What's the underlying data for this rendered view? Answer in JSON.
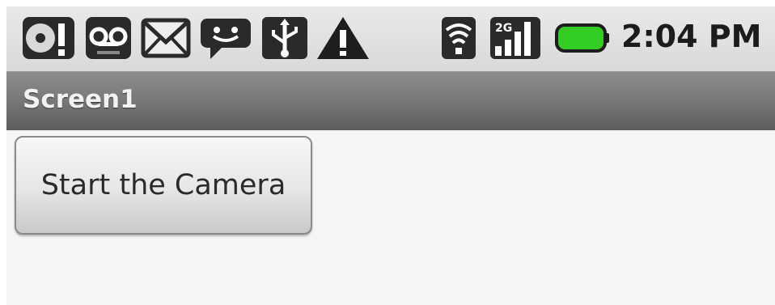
{
  "status_bar": {
    "icons": [
      "voicemail-alert-icon",
      "voicemail-icon",
      "gmail-icon",
      "chat-icon",
      "usb-icon",
      "warning-icon",
      "wifi-icon",
      "signal-2g-icon",
      "battery-icon"
    ],
    "signal_label": "2G",
    "time": "2:04 PM",
    "battery_color": "#33cc22"
  },
  "title_bar": {
    "title": "Screen1"
  },
  "main": {
    "camera_button_label": "Start the Camera"
  }
}
